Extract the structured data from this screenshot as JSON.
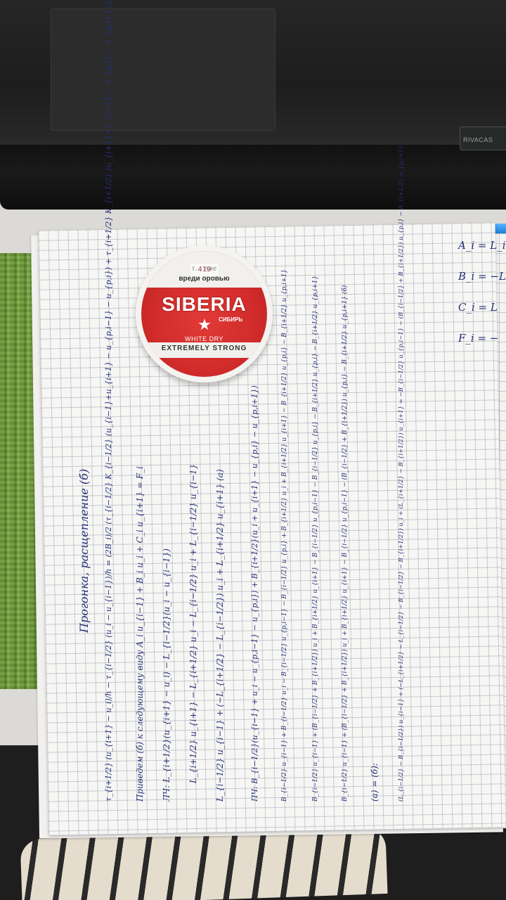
{
  "laptop": {
    "brand": "RIVACAS"
  },
  "snus_can": {
    "warning_top": "т…        лие",
    "warning_bottom": "вреди     оровью",
    "sticker_text": "419",
    "brand": "SIBERIA",
    "brand_cyrillic": "СИБИРЬ",
    "variant": "WHITE DRY",
    "strength": "EXTREMELY STRONG"
  },
  "notes": {
    "title": "Прогонка, расщепление (б)",
    "lines": [
      "τ_{i+1/2} (u_{i+1} − u_i)/h − τ_{i−1/2} (u_i − u_{i−1})/h = (2B_i)/2 (τ_{i−1/2} K_{i−1/2} (u_{i−1}+u_{i+1} − u_{p,i−1} − u_{p,i}) + τ_{i+1/2} K_{i+1/2} (u_{i+1}+u_{i+1} − u_{p,i} − u_{p,i+1}))",
      "Приведем (б) к следующему виду  A_i u_{i−1} + B_i u_i + C_i u_{i+1} = F_i",
      "ЛЧ: L_{i+1/2}(u_{i+1} − u_i) − L_{i−1/2}(u_i − u_{i−1})",
      "L_{i+1/2} u_{i+1} − L_{i+1/2} u_i − L_{i−1/2} u_i + L_{i−1/2} u_{i−1}",
      "L_{i−1/2} u_{i−1} + (−L_{i+1/2} − L_{i−1/2}) u_i + L_{i+1/2} u_{i+1}      (a)",
      "ПЧ: B_{i−1/2}(u_{i−1} + u_i − u_{p,i−1} − u_{p,i}) + B_{i+1/2}(u_i + u_{i+1} − u_{p,i} − u_{p,i+1})",
      "B_{i−1/2} u_{i−1} + B_{i−1/2} u_i − B_{i−1/2} u_{p,i−1} − B_{i−1/2} u_{p,i} + B_{i+1/2} u_i + B_{i+1/2} u_{i+1} − B_{i+1/2} u_{p,i} − B_{i+1/2} u_{p,i+1}",
      "B_{i−1/2} u_{i−1} + (B_{i−1/2} + B_{i+1/2}) u_i + B_{i+1/2} u_{i+1} − B_{i−1/2} u_{p,i−1} − B_{i−1/2} u_{p,i} − B_{i+1/2} u_{p,i} − B_{i+1/2} u_{p,i+1}",
      "B_{i−1/2} u_{i−1} + (B_{i−1/2} + B_{i+1/2}) u_i + B_{i+1/2} u_{i+1} − B_{i−1/2} u_{p,i−1} − (B_{i−1/2} + B_{i+1/2}) u_{p,i} − B_{i+1/2} u_{p,i+1}   (б)",
      "(a) = (б):",
      "(L_{i−1/2} − B_{i−1/2}) u_{i−1} + (−L_{i+1/2} − L_{i−1/2} − B_{i−1/2} − B_{i+1/2}) u_i + (L_{i+1/2} − B_{i+1/2}) u_{i+1} = −B_{i−1/2} u_{p,i−1} − (B_{i−1/2} + B_{i+1/2}) u_{p,i} − B_{i+1/2} u_{p,i+1}"
    ],
    "side": [
      "A_i = L_i",
      "B_i = −L",
      "C_i = L",
      "F_i = −"
    ]
  }
}
